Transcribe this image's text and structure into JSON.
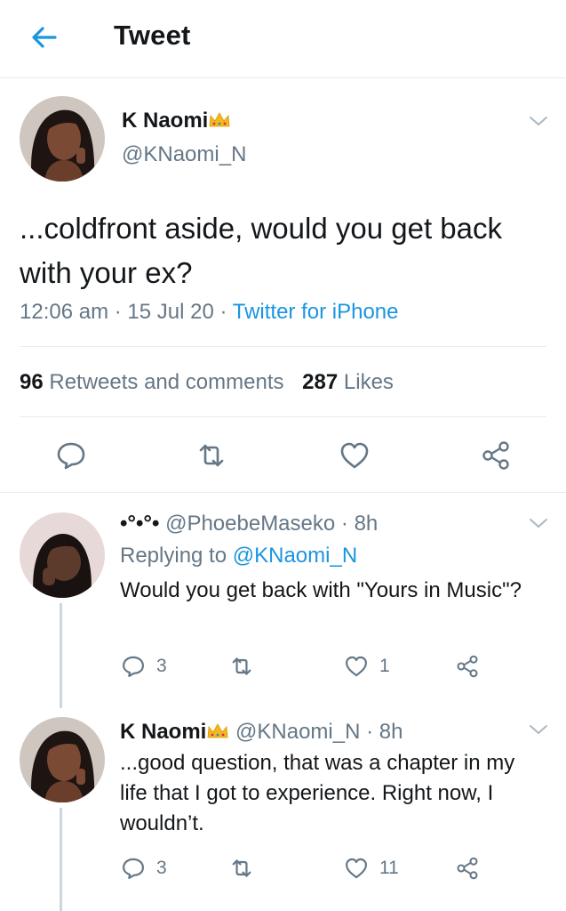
{
  "header": {
    "title": "Tweet"
  },
  "main_tweet": {
    "name": "K Naomi",
    "handle": "@KNaomi_N",
    "text": "...coldfront aside, would you get back with your ex?",
    "time": "12:06 am",
    "date": "15 Jul 20",
    "source": "Twitter for iPhone",
    "retweets_count": "96",
    "retweets_label": "Retweets and comments",
    "likes_count": "287",
    "likes_label": "Likes"
  },
  "replies": [
    {
      "name": "•°•°•",
      "handle": "@PhoebeMaseko",
      "time": "8h",
      "replying_label": "Replying to",
      "replying_to": "@KNaomi_N",
      "text": "Would you get back with \"Yours in Music\"?",
      "comments": "3",
      "likes": "1"
    },
    {
      "name": "K Naomi",
      "handle": "@KNaomi_N",
      "time": "8h",
      "text": "...good question, that was a chapter in my life that I got to experience. Right now, I wouldn’t.",
      "comments": "3",
      "likes": "11"
    }
  ],
  "colors": {
    "accent": "#1b95e0",
    "muted": "#657786",
    "divider": "#e6ecf0"
  }
}
